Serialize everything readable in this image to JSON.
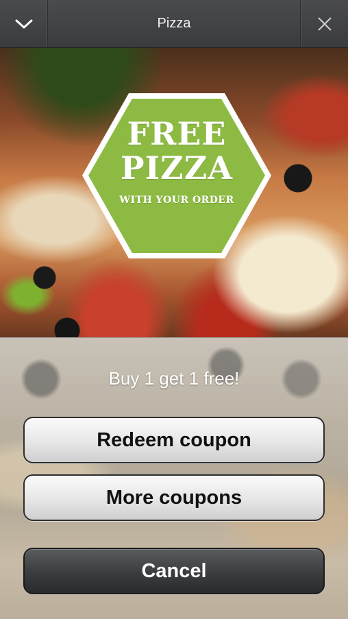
{
  "header": {
    "title": "Pizza",
    "left_icon": "chevron-down-icon",
    "right_icon": "close-icon"
  },
  "banner": {
    "line1": "FREE",
    "line2": "PIZZA",
    "line3": "WITH YOUR ORDER",
    "badge_color": "#8cba42"
  },
  "offer": {
    "text": "Buy 1 get 1 free!"
  },
  "actions": {
    "redeem_label": "Redeem coupon",
    "more_label": "More coupons",
    "cancel_label": "Cancel"
  }
}
